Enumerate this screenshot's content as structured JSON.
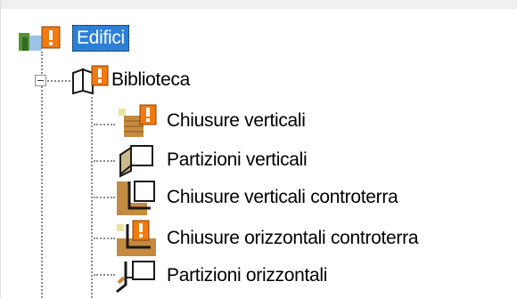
{
  "tree": {
    "root": {
      "label": "Edifici",
      "icon": "building-warning-icon",
      "selected": true
    },
    "library": {
      "label": "Biblioteca",
      "icon": "book-warning-icon",
      "expanded": true
    },
    "items": [
      {
        "label": "Chiusure verticali",
        "icon": "wall-warning-icon"
      },
      {
        "label": "Partizioni verticali",
        "icon": "vertical-partition-icon"
      },
      {
        "label": "Chiusure verticali controterra",
        "icon": "retaining-wall-icon"
      },
      {
        "label": "Chiusure orizzontali controterra",
        "icon": "ground-slab-warning-icon"
      },
      {
        "label": "Partizioni orizzontali",
        "icon": "floor-partition-icon"
      }
    ]
  },
  "colors": {
    "selection": "#2b7fd6",
    "warning": "#f07a10",
    "brick": "#c58a3f"
  }
}
